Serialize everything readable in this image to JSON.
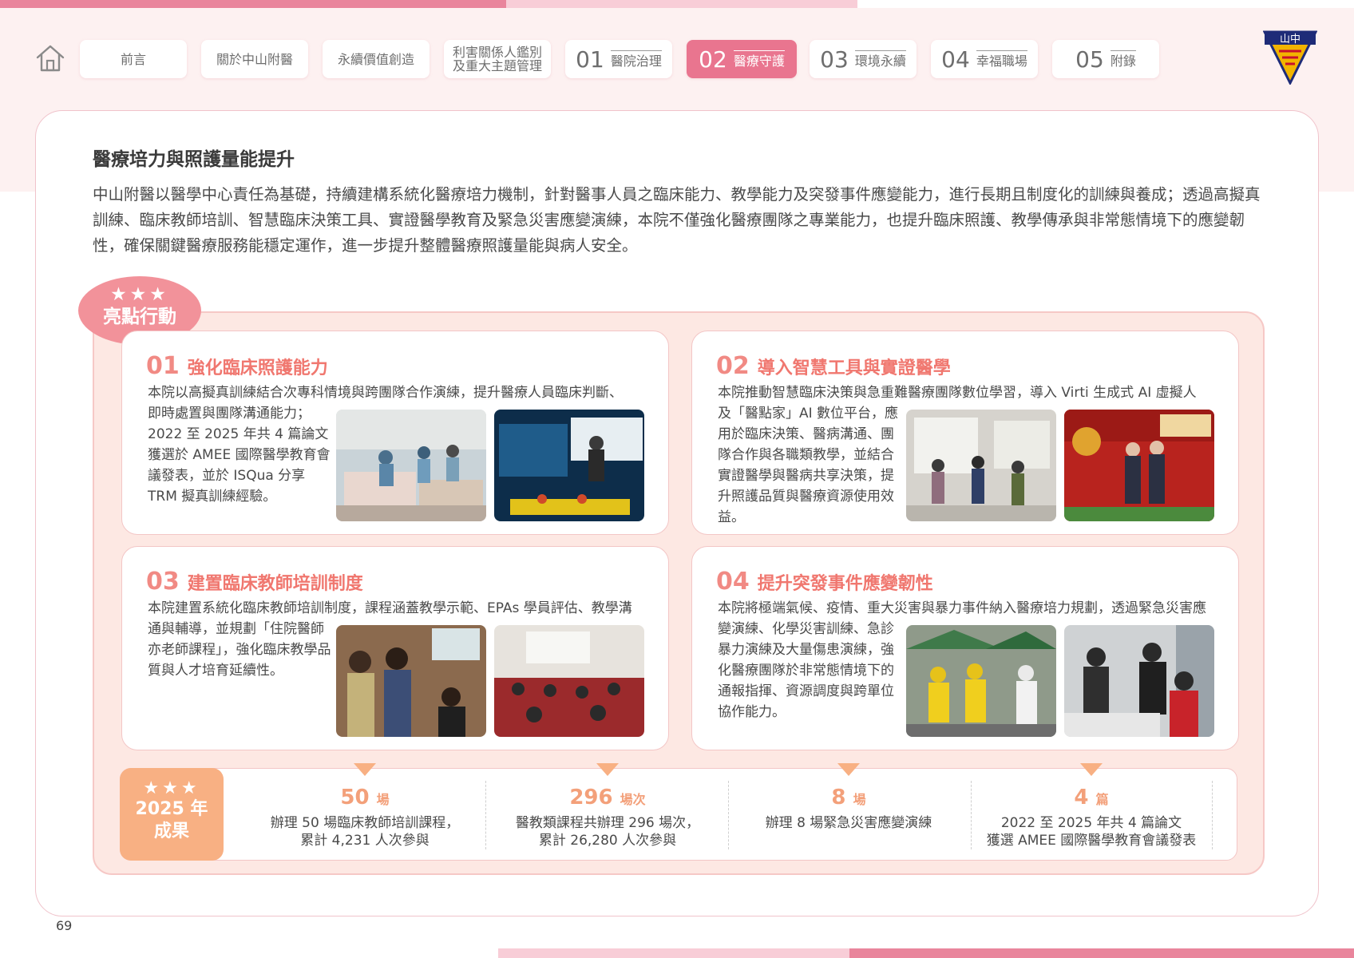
{
  "nav": {
    "items": [
      {
        "label": "前言"
      },
      {
        "label": "關於中山附醫"
      },
      {
        "label": "永續價值創造"
      },
      {
        "label": "利害關係人鑑別\n及重大主題管理"
      },
      {
        "num": "01",
        "label": "醫院治理"
      },
      {
        "num": "02",
        "label": "醫療守護"
      },
      {
        "num": "03",
        "label": "環境永續"
      },
      {
        "num": "04",
        "label": "幸福職場"
      },
      {
        "num": "05",
        "label": "附錄"
      }
    ],
    "active_index": 5
  },
  "logo": {
    "text": "山中"
  },
  "section": {
    "title": "醫療培力與照護量能提升",
    "intro": "中山附醫以醫學中心責任為基礎，持續建構系統化醫療培力機制，針對醫事人員之臨床能力、教學能力及突發事件應變能力，進行長期且制度化的訓練與養成；透過高擬真訓練、臨床教師培訓、智慧臨床決策工具、實證醫學教育及緊急災害應變演練，本院不僅強化醫療團隊之專業能力，也提升臨床照護、教學傳承與非常態情境下的應變韌性，確保關鍵醫療服務能穩定運作，進一步提升整體醫療照護量能與病人安全。"
  },
  "highlight_badge": {
    "stars": "★★★",
    "label": "亮點行動"
  },
  "cards": [
    {
      "num": "01",
      "title": "強化臨床照護能力",
      "desc_first": "本院以高擬真訓練結合次專科情境與跨團隊合作演練，提升醫療人員臨床判斷、",
      "desc_rest": "即時處置與團隊溝通能力；2022 至 2025 年共 4 篇論文獲選於 AMEE 國際醫學教育會議發表，並於 ISQua 分享 TRM 擬真訓練經驗。"
    },
    {
      "num": "02",
      "title": "導入智慧工具與實證醫學",
      "desc_first": "本院推動智慧臨床決策與急重難醫療團隊數位學習，導入 Virti 生成式 AI 虛擬人",
      "desc_rest": "及「醫點家」AI 數位平台，應用於臨床決策、醫病溝通、團隊合作與各職類教學，並結合實證醫學與醫病共享決策，提升照護品質與醫療資源使用效益。"
    },
    {
      "num": "03",
      "title": "建置臨床教師培訓制度",
      "desc_first": "本院建置系統化臨床教師培訓制度，課程涵蓋教學示範、EPAs 學員評估、教學溝",
      "desc_rest": "通與輔導，並規劃「住院醫師亦老師課程」，強化臨床教學品質與人才培育延續性。"
    },
    {
      "num": "04",
      "title": "提升突發事件應變韌性",
      "desc_first": "本院將極端氣候、疫情、重大災害與暴力事件納入醫療培力規劃，透過緊急災害應",
      "desc_rest": "變演練、化學災害訓練、急診暴力演練及大量傷患演練，強化醫療團隊於非常態情境下的通報指揮、資源調度與跨單位協作能力。"
    }
  ],
  "results_badge": {
    "stars": "★★★",
    "year": "2025 年",
    "label": "成果"
  },
  "results": [
    {
      "value": "50",
      "unit": "場",
      "desc": "辦理 50 場臨床教師培訓課程，\n累計 4,231 人次參與"
    },
    {
      "value": "296",
      "unit": "場次",
      "desc": "醫教類課程共辦理 296 場次，\n累計 26,280 人次參與"
    },
    {
      "value": "8",
      "unit": "場",
      "desc": "辦理 8 場緊急災害應變演練"
    },
    {
      "value": "4",
      "unit": "篇",
      "desc": "2022 至 2025 年共 4 篇論文\n獲選 AMEE 國際醫學教育會議發表"
    }
  ],
  "page_number": "69",
  "colors": {
    "accent": "#e9758f",
    "orange": "#f8b083",
    "title_red": "#f0776f"
  }
}
